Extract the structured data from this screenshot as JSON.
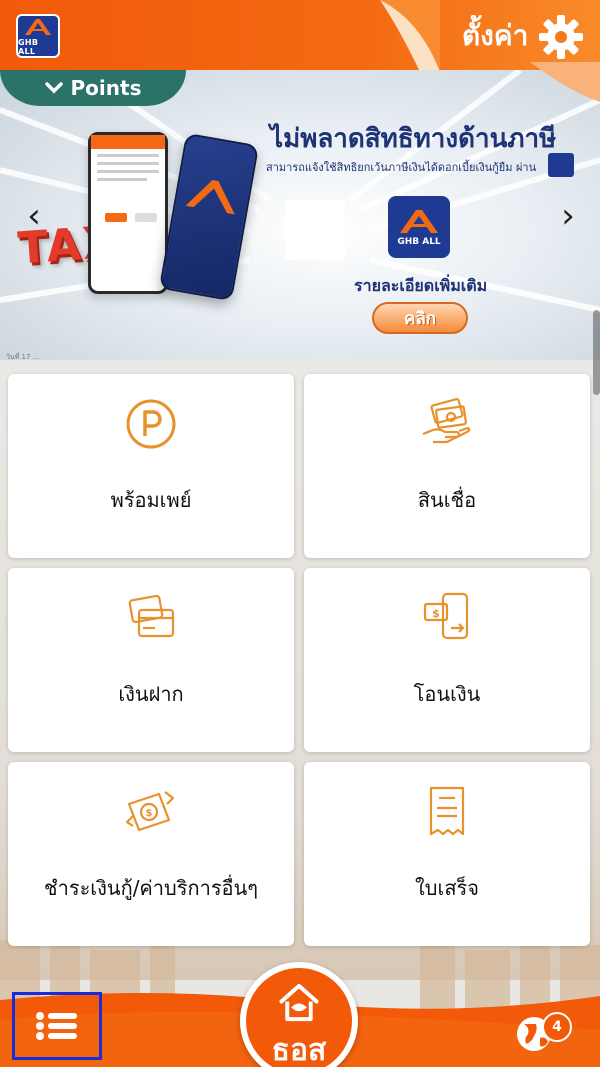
{
  "header": {
    "logo_text": "GHB ALL",
    "settings_label": "ตั้งค่า",
    "settings_icon": "gear-icon",
    "brand_color": "#f25a0a"
  },
  "points_tab": {
    "label": "Points"
  },
  "banner": {
    "headline": "ไม่พลาดสิทธิทางด้านภาษี",
    "subtext": "สามารถแจ้งใช้สิทธิยกเว้นภาษีเงินได้ดอกเบี้ยเงินกู้ยืม ผ่าน",
    "tax_word": "TAX",
    "logo_text": "GHB ALL",
    "detail": "รายละเอียดเพิ่มเติม",
    "click_label": "คลิก",
    "date": "วันที่ 17 ...",
    "prev_icon": "chevron-left-icon",
    "next_icon": "chevron-right-icon"
  },
  "menu": [
    {
      "label": "พร้อมเพย์",
      "icon": "promptpay-icon"
    },
    {
      "label": "สินเชื่อ",
      "icon": "loan-icon"
    },
    {
      "label": "เงินฝาก",
      "icon": "deposit-icon"
    },
    {
      "label": "โอนเงิน",
      "icon": "transfer-icon"
    },
    {
      "label": "ชำระเงินกู้/ค่าบริการอื่นๆ",
      "icon": "payment-icon"
    },
    {
      "label": "ใบเสร็จ",
      "icon": "receipt-icon"
    }
  ],
  "bottom_nav": {
    "menu_icon": "hamburger-menu-icon",
    "home_label": "ธอส",
    "language_icon": "globe-icon",
    "notification_count": "4"
  },
  "colors": {
    "icon_orange": "#e8912d",
    "navy": "#1e3276",
    "teal": "#2a7366"
  }
}
